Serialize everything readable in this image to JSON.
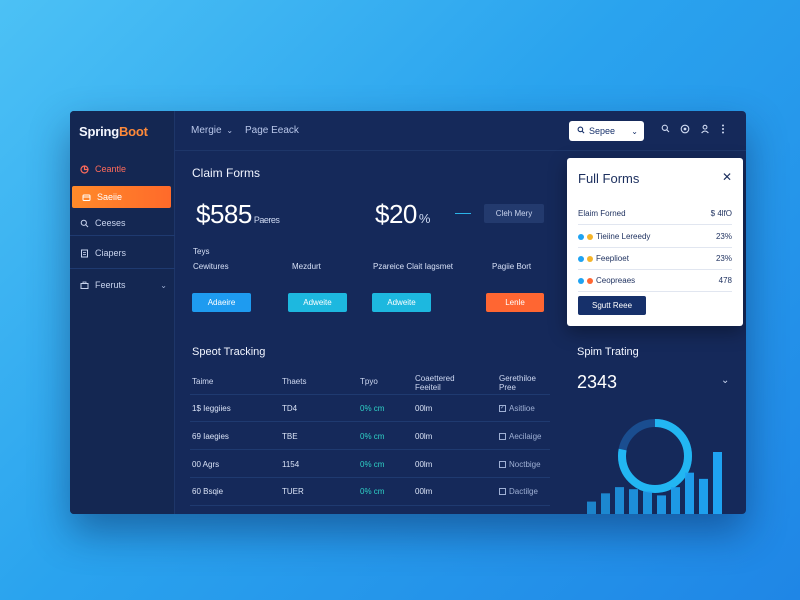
{
  "app": {
    "logo_main": "Spring",
    "logo_accent": "Boot"
  },
  "sidebar": {
    "items": [
      {
        "label": "Ceantle",
        "icon": "chart-icon"
      },
      {
        "label": "Saeiie",
        "icon": "folder-icon"
      },
      {
        "label": "Ceeses",
        "icon": "search-icon"
      },
      {
        "label": "Ciapers",
        "icon": "document-icon"
      },
      {
        "label": "Feeruts",
        "icon": "briefcase-icon"
      }
    ]
  },
  "topbar": {
    "crumb_1": "Mergie",
    "crumb_1_chevron": "⌄",
    "crumb_2": "Page Eeack",
    "search_label": "Sepee",
    "search_chevron": "⌄"
  },
  "claim_forms": {
    "title": "Claim Forms",
    "stat_1_value": "$585",
    "stat_1_unit": "Paeres",
    "stat_2_value": "$20",
    "stat_2_unit": "%",
    "chip_label": "Cleh Mery",
    "labels": [
      {
        "line1": "Teys",
        "line2": "Cewitures"
      },
      {
        "line1": "",
        "line2": "Mezdurt"
      },
      {
        "line1": "",
        "line2": "Pzareice Clait Iagsmet"
      },
      {
        "line1": "",
        "line2": "Pagiie Bort"
      }
    ],
    "buttons": [
      "Adaeire",
      "Adweite",
      "Adweite",
      "Lenle"
    ]
  },
  "tracking": {
    "title": "Speot Tracking",
    "headers": [
      "Taime",
      "Thaets",
      "Tpyo",
      "Coaettered Feeiteil",
      "Gerethiloe Pree"
    ],
    "rows": [
      [
        "1$ Ieggiies",
        "TD4",
        "0% cm",
        "00lm",
        "Asitlioe"
      ],
      [
        "69 Iaegies",
        "TBE",
        "0% cm",
        "00lm",
        "Aecilaige"
      ],
      [
        "00 Agrs",
        "1154",
        "0% cm",
        "00lm",
        "Noctbige"
      ],
      [
        "60 Bsqie",
        "TUER",
        "0% cm",
        "00lm",
        "Dactilge"
      ]
    ]
  },
  "full_forms": {
    "title": "Full Forms",
    "close_icon": "close-icon",
    "rows": [
      {
        "label": "Elaim Forned",
        "value": "$ 4lfO"
      },
      {
        "label": "Tieiine Lereedy",
        "value": "23%"
      },
      {
        "label": "Feeplioet",
        "value": "23%"
      },
      {
        "label": "Ceopreaes",
        "value": "478"
      }
    ],
    "button": "Sgutt Reee"
  },
  "spin_tracking": {
    "title": "Spim Trating",
    "value": "2343",
    "chevron": "⌄"
  },
  "chart_data": {
    "type": "bar",
    "values": [
      12,
      20,
      26,
      24,
      22,
      18,
      26,
      40,
      34,
      60
    ],
    "ring_progress": 0.78,
    "colors": {
      "bar": "#1fa3f2",
      "ring": "#22b6f2",
      "ring_track": "#1a4d8f"
    }
  },
  "colors": {
    "accent_orange": "#ff7a2a",
    "teal": "#2fd1c6",
    "navy": "#15295a"
  }
}
